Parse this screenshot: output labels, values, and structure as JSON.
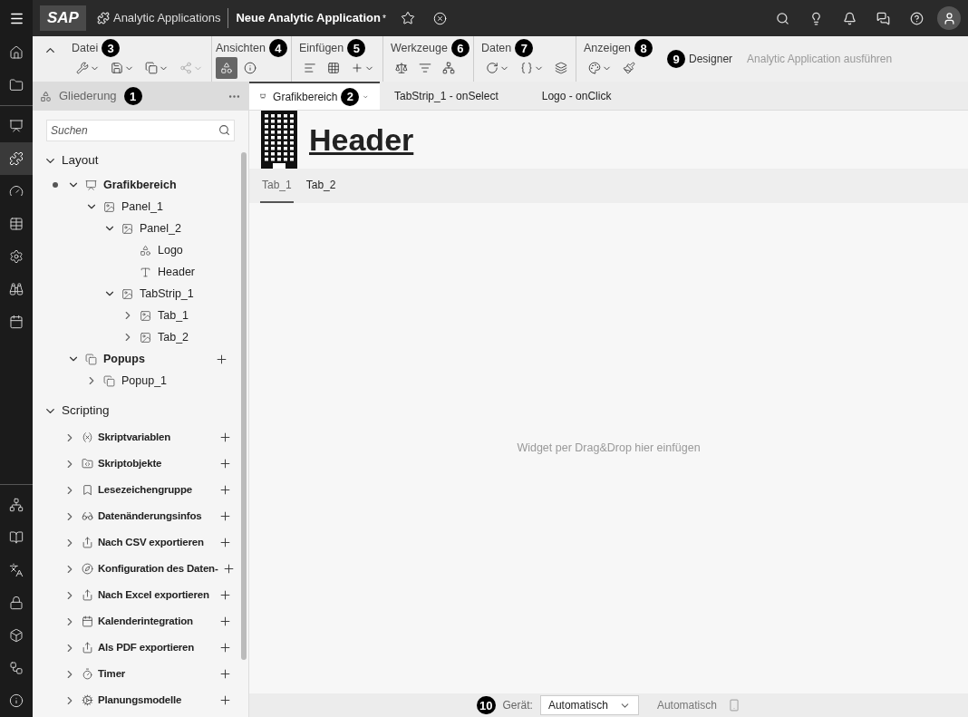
{
  "shell": {
    "logo": "SAP",
    "app_name": "Analytic Applications",
    "doc_title": "Neue Analytic Application",
    "modified_mark": "*"
  },
  "rail": {
    "top": [
      {
        "kind": "home",
        "selected": false
      },
      {
        "kind": "folder",
        "selected": false
      }
    ],
    "middle": [
      {
        "kind": "presentation",
        "selected": false
      },
      {
        "kind": "app",
        "selected": true
      },
      {
        "kind": "gauge",
        "selected": false
      },
      {
        "kind": "table",
        "selected": false
      },
      {
        "kind": "settings",
        "selected": false
      },
      {
        "kind": "binoculars",
        "selected": false
      },
      {
        "kind": "calendar",
        "selected": false
      }
    ],
    "bottom": [
      {
        "kind": "network",
        "selected": false
      },
      {
        "kind": "book",
        "selected": false
      },
      {
        "kind": "translate",
        "selected": false
      },
      {
        "kind": "lock",
        "selected": false
      },
      {
        "kind": "box",
        "selected": false
      },
      {
        "kind": "flow",
        "selected": false
      },
      {
        "kind": "info",
        "selected": false
      }
    ]
  },
  "toolbar": {
    "groups": [
      {
        "label": "Datei",
        "callout": "3",
        "tools": [
          {
            "kind": "wrench",
            "dropdown": true,
            "selected": false,
            "disabled": false
          },
          {
            "kind": "save",
            "dropdown": true,
            "selected": false,
            "disabled": false
          },
          {
            "kind": "copy",
            "dropdown": true,
            "selected": false,
            "disabled": false
          },
          {
            "kind": "share",
            "dropdown": true,
            "selected": false,
            "disabled": true
          }
        ]
      },
      {
        "label": "Ansichten",
        "callout": "4",
        "tools": [
          {
            "kind": "outline",
            "dropdown": false,
            "selected": true,
            "disabled": false
          },
          {
            "kind": "info",
            "dropdown": false,
            "selected": false,
            "disabled": false
          }
        ]
      },
      {
        "label": "Einfügen",
        "callout": "5",
        "tools": [
          {
            "kind": "chart",
            "dropdown": false,
            "selected": false,
            "disabled": false
          },
          {
            "kind": "grid",
            "dropdown": false,
            "selected": false,
            "disabled": false
          },
          {
            "kind": "plus",
            "dropdown": true,
            "selected": false,
            "disabled": false
          }
        ]
      },
      {
        "label": "Werkzeuge",
        "callout": "6",
        "tools": [
          {
            "kind": "scale",
            "dropdown": false,
            "selected": false,
            "disabled": false
          },
          {
            "kind": "filter",
            "dropdown": false,
            "selected": false,
            "disabled": false
          },
          {
            "kind": "network",
            "dropdown": false,
            "selected": false,
            "disabled": false
          }
        ]
      },
      {
        "label": "Daten",
        "callout": "7",
        "tools": [
          {
            "kind": "refresh",
            "dropdown": true,
            "selected": false,
            "disabled": false
          },
          {
            "kind": "braces",
            "dropdown": true,
            "selected": false,
            "disabled": false
          },
          {
            "kind": "layers",
            "dropdown": false,
            "selected": false,
            "disabled": false
          }
        ]
      },
      {
        "label": "Anzeigen",
        "callout": "8",
        "tools": [
          {
            "kind": "palette",
            "dropdown": true,
            "selected": false,
            "disabled": false
          },
          {
            "kind": "brush",
            "dropdown": false,
            "selected": false,
            "disabled": false
          }
        ]
      }
    ],
    "mode": {
      "callout": "9",
      "label": "Designer"
    },
    "run": {
      "label": "Analytic Application ausführen",
      "disabled": true
    }
  },
  "outline": {
    "title": "Gliederung",
    "callout": "1",
    "search": {
      "placeholder": "Suchen"
    },
    "sections": [
      {
        "label": "Layout",
        "expanded": true,
        "children": [
          {
            "label": "Grafikbereich",
            "kind": "canvas",
            "bold": true,
            "current": true,
            "add": false,
            "expanded": true,
            "children": [
              {
                "label": "Panel_1",
                "kind": "panel",
                "bold": false,
                "add": false,
                "expanded": true,
                "children": [
                  {
                    "label": "Panel_2",
                    "kind": "panel",
                    "bold": false,
                    "add": false,
                    "expanded": true,
                    "children": [
                      {
                        "label": "Logo",
                        "kind": "shape",
                        "bold": false,
                        "add": false
                      },
                      {
                        "label": "Header",
                        "kind": "text",
                        "bold": false,
                        "add": false
                      }
                    ]
                  },
                  {
                    "label": "TabStrip_1",
                    "kind": "panel",
                    "bold": false,
                    "add": false,
                    "expanded": true,
                    "children": [
                      {
                        "label": "Tab_1",
                        "kind": "panel",
                        "bold": false,
                        "add": false,
                        "expanded": false
                      },
                      {
                        "label": "Tab_2",
                        "kind": "panel",
                        "bold": false,
                        "add": false,
                        "expanded": false
                      }
                    ]
                  }
                ]
              }
            ]
          },
          {
            "label": "Popups",
            "kind": "popup",
            "bold": true,
            "add": true,
            "expanded": true,
            "children": [
              {
                "label": "Popup_1",
                "kind": "popup",
                "bold": false,
                "add": false,
                "expanded": false
              }
            ]
          }
        ]
      },
      {
        "label": "Scripting",
        "expanded": true,
        "children": [
          {
            "label": "Skriptvariablen",
            "kind": "variable",
            "bold": true,
            "add": true,
            "expanded": false
          },
          {
            "label": "Skriptobjekte",
            "kind": "script",
            "bold": true,
            "add": true,
            "expanded": false
          },
          {
            "label": "Lesezeichengruppe",
            "kind": "bookmark",
            "bold": true,
            "add": true,
            "expanded": false
          },
          {
            "label": "Datenänderungsinfos",
            "kind": "glasses",
            "bold": true,
            "add": true,
            "expanded": false
          },
          {
            "label": "Nach CSV exportieren",
            "kind": "export",
            "bold": true,
            "add": true,
            "expanded": false
          },
          {
            "label": "Konfiguration des Daten-",
            "kind": "compass",
            "bold": true,
            "add": true,
            "expanded": false
          },
          {
            "label": "Nach Excel exportieren",
            "kind": "export",
            "bold": true,
            "add": true,
            "expanded": false
          },
          {
            "label": "Kalenderintegration",
            "kind": "calendar",
            "bold": true,
            "add": true,
            "expanded": false
          },
          {
            "label": "Als PDF exportieren",
            "kind": "export",
            "bold": true,
            "add": true,
            "expanded": false
          },
          {
            "label": "Timer",
            "kind": "timer",
            "bold": true,
            "add": true,
            "expanded": false
          },
          {
            "label": "Planungsmodelle",
            "kind": "cog",
            "bold": true,
            "add": true,
            "expanded": false
          }
        ]
      }
    ]
  },
  "editor_tabs": [
    {
      "label": "Grafikbereich",
      "selected": true,
      "callout": "2",
      "dropdown": true
    },
    {
      "label": "TabStrip_1 - onSelect",
      "selected": false
    },
    {
      "label": "Logo - onClick",
      "selected": false
    }
  ],
  "canvas": {
    "header": "Header",
    "tabs": [
      {
        "label": "Tab_1",
        "selected": true
      },
      {
        "label": "Tab_2",
        "selected": false
      }
    ],
    "drop_hint": "Widget per Drag&Drop hier einfügen"
  },
  "footer": {
    "callout": "10",
    "device_label": "Gerät:",
    "device_value": "Automatisch",
    "orientation": "Automatisch"
  }
}
